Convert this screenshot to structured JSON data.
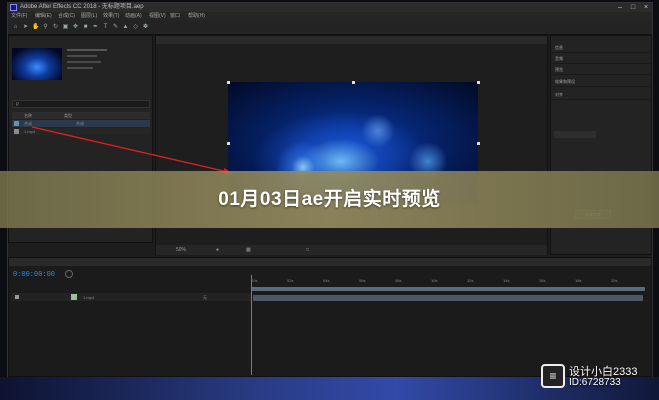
{
  "window": {
    "title": "Adobe After Effects CC 2018 - 无标题项目.aep"
  },
  "menu": [
    "文件(F)",
    "编辑(E)",
    "合成(C)",
    "图层(L)",
    "效果(T)",
    "动画(A)",
    "视图(V)",
    "窗口",
    "帮助(H)"
  ],
  "project": {
    "search_placeholder": "ρ",
    "columns": [
      "名称",
      "类型"
    ],
    "items": [
      {
        "name": "合成",
        "type": "合成"
      },
      {
        "name": "1.mp4",
        "type": ""
      }
    ]
  },
  "composition": {
    "zoom": "50%"
  },
  "right_panel": {
    "items": [
      "信息",
      "音频",
      "预览",
      "效果和预设",
      "对齐"
    ],
    "button": "处理文库"
  },
  "timeline": {
    "timecode": "0:00:00:00",
    "layer_name": "1.mp4",
    "layer_mode": "无",
    "ticks": [
      "00s",
      "02s",
      "04s",
      "06s",
      "08s",
      "10s",
      "12s",
      "14s",
      "16s",
      "18s",
      "20s"
    ]
  },
  "banner": {
    "text": "01月03日ae开启实时预览"
  },
  "watermark": {
    "line1": "设计小白2333",
    "line2": "ID:6728733"
  },
  "colors": {
    "banner_bg": "#968c5f",
    "timeline_accent": "#2d8ceb",
    "arrow": "#e02020"
  }
}
